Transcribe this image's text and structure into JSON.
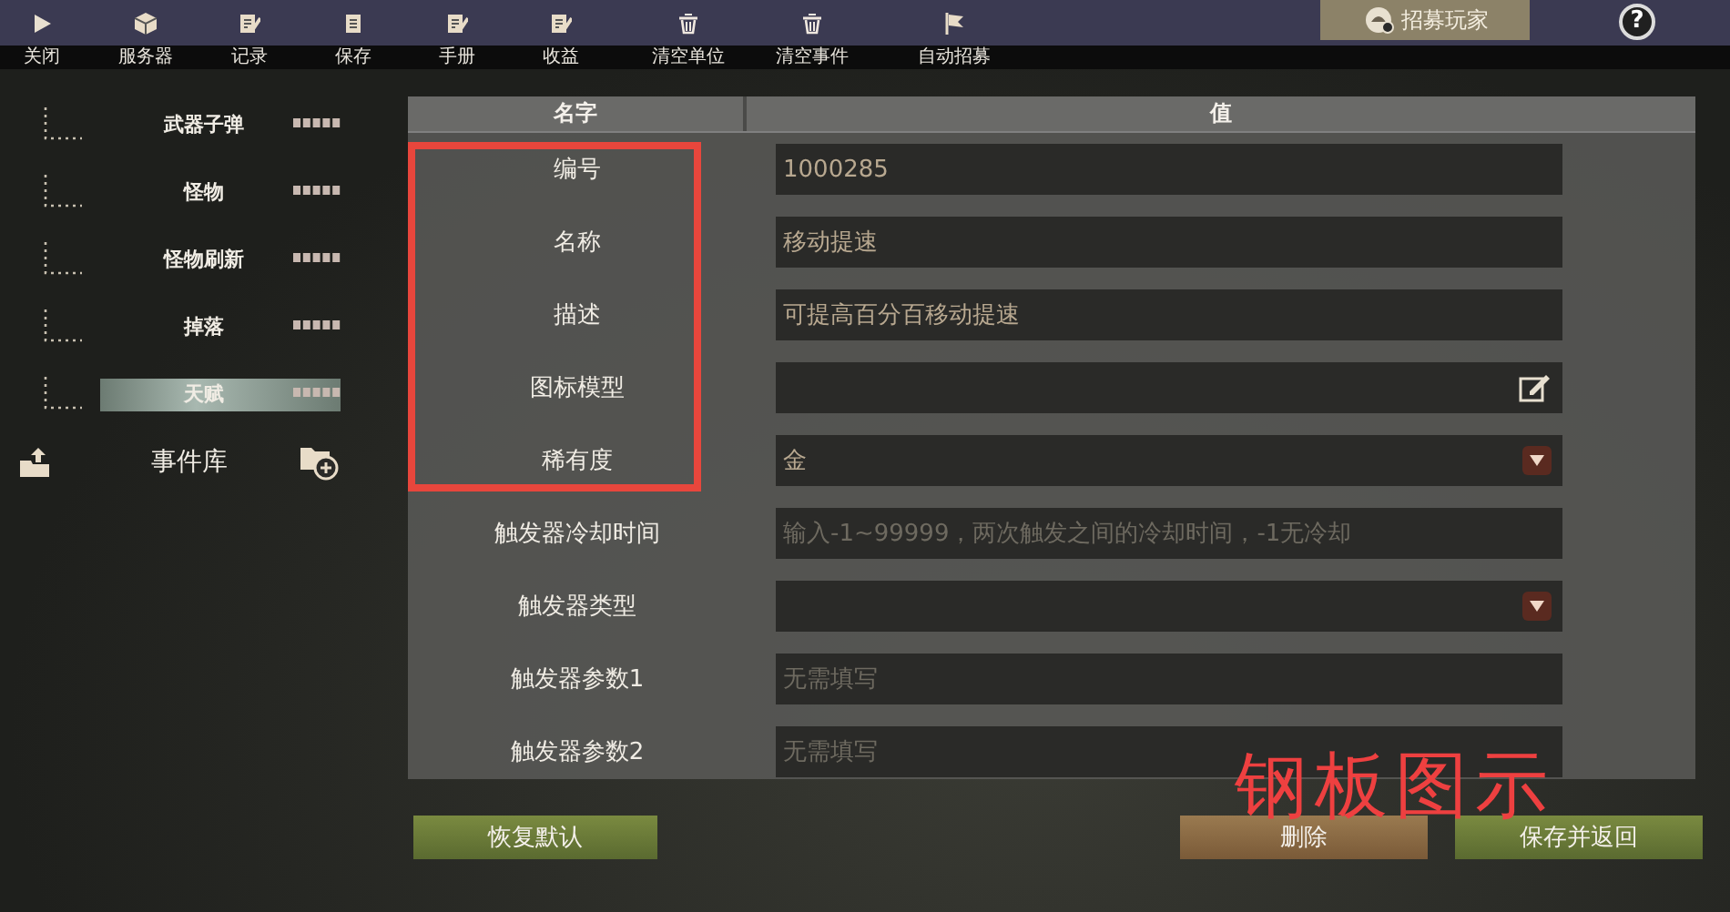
{
  "toolbar": [
    {
      "label": "关闭",
      "kind": "play"
    },
    {
      "label": "服务器",
      "kind": "cube"
    },
    {
      "label": "记录",
      "kind": "edit"
    },
    {
      "label": "保存",
      "kind": "doc"
    },
    {
      "label": "手册",
      "kind": "edit"
    },
    {
      "label": "收益",
      "kind": "edit"
    },
    {
      "label": "清空单位",
      "kind": "trash"
    },
    {
      "label": "清空事件",
      "kind": "trash"
    },
    {
      "label": "自动招募",
      "kind": "flag"
    }
  ],
  "recruit_tab": {
    "label": "招募玩家"
  },
  "help": {
    "label": "?"
  },
  "sidebar": {
    "items": [
      {
        "label": "武器子弹",
        "selected": false
      },
      {
        "label": "怪物",
        "selected": false
      },
      {
        "label": "怪物刷新",
        "selected": false
      },
      {
        "label": "掉落",
        "selected": false
      },
      {
        "label": "天赋",
        "selected": true
      }
    ],
    "library": {
      "label": "事件库"
    }
  },
  "table": {
    "columns": [
      "名字",
      "值"
    ],
    "rows": [
      {
        "name": "编号",
        "kind": "text",
        "value": "1000285"
      },
      {
        "name": "名称",
        "kind": "text",
        "value": "移动提速"
      },
      {
        "name": "描述",
        "kind": "text",
        "value": "可提高百分百移动提速"
      },
      {
        "name": "图标模型",
        "kind": "edit"
      },
      {
        "name": "稀有度",
        "kind": "select",
        "value": "金"
      },
      {
        "name": "触发器冷却时间",
        "kind": "text",
        "placeholder": "输入-1~99999，两次触发之间的冷却时间，-1无冷却"
      },
      {
        "name": "触发器类型",
        "kind": "select"
      },
      {
        "name": "触发器参数1",
        "kind": "text",
        "placeholder": "无需填写"
      },
      {
        "name": "触发器参数2",
        "kind": "text",
        "placeholder": "无需填写"
      }
    ]
  },
  "buttons": [
    {
      "label": "恢复默认",
      "kind": "reset"
    },
    {
      "label": "删除",
      "kind": "delete"
    },
    {
      "label": "保存并返回",
      "kind": "save"
    }
  ],
  "annotation": {
    "label": "钢板图示"
  }
}
